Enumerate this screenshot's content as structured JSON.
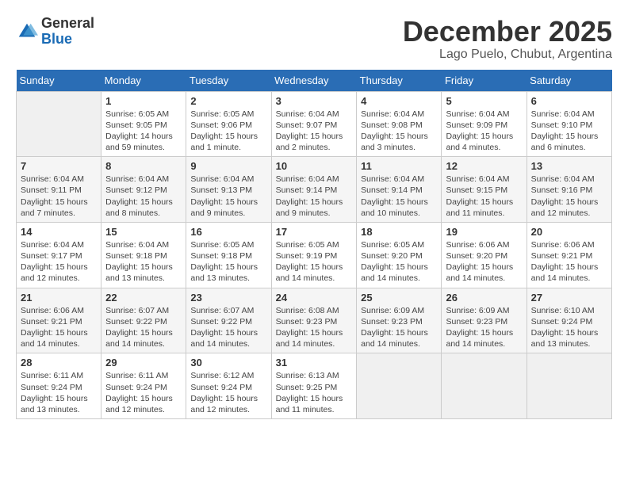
{
  "header": {
    "logo_general": "General",
    "logo_blue": "Blue",
    "month": "December 2025",
    "location": "Lago Puelo, Chubut, Argentina"
  },
  "weekdays": [
    "Sunday",
    "Monday",
    "Tuesday",
    "Wednesday",
    "Thursday",
    "Friday",
    "Saturday"
  ],
  "weeks": [
    [
      {
        "day": "",
        "empty": true
      },
      {
        "day": "1",
        "sunrise": "6:05 AM",
        "sunset": "9:05 PM",
        "daylight": "14 hours and 59 minutes."
      },
      {
        "day": "2",
        "sunrise": "6:05 AM",
        "sunset": "9:06 PM",
        "daylight": "15 hours and 1 minute."
      },
      {
        "day": "3",
        "sunrise": "6:04 AM",
        "sunset": "9:07 PM",
        "daylight": "15 hours and 2 minutes."
      },
      {
        "day": "4",
        "sunrise": "6:04 AM",
        "sunset": "9:08 PM",
        "daylight": "15 hours and 3 minutes."
      },
      {
        "day": "5",
        "sunrise": "6:04 AM",
        "sunset": "9:09 PM",
        "daylight": "15 hours and 4 minutes."
      },
      {
        "day": "6",
        "sunrise": "6:04 AM",
        "sunset": "9:10 PM",
        "daylight": "15 hours and 6 minutes."
      }
    ],
    [
      {
        "day": "7",
        "sunrise": "6:04 AM",
        "sunset": "9:11 PM",
        "daylight": "15 hours and 7 minutes."
      },
      {
        "day": "8",
        "sunrise": "6:04 AM",
        "sunset": "9:12 PM",
        "daylight": "15 hours and 8 minutes."
      },
      {
        "day": "9",
        "sunrise": "6:04 AM",
        "sunset": "9:13 PM",
        "daylight": "15 hours and 9 minutes."
      },
      {
        "day": "10",
        "sunrise": "6:04 AM",
        "sunset": "9:14 PM",
        "daylight": "15 hours and 9 minutes."
      },
      {
        "day": "11",
        "sunrise": "6:04 AM",
        "sunset": "9:14 PM",
        "daylight": "15 hours and 10 minutes."
      },
      {
        "day": "12",
        "sunrise": "6:04 AM",
        "sunset": "9:15 PM",
        "daylight": "15 hours and 11 minutes."
      },
      {
        "day": "13",
        "sunrise": "6:04 AM",
        "sunset": "9:16 PM",
        "daylight": "15 hours and 12 minutes."
      }
    ],
    [
      {
        "day": "14",
        "sunrise": "6:04 AM",
        "sunset": "9:17 PM",
        "daylight": "15 hours and 12 minutes."
      },
      {
        "day": "15",
        "sunrise": "6:04 AM",
        "sunset": "9:18 PM",
        "daylight": "15 hours and 13 minutes."
      },
      {
        "day": "16",
        "sunrise": "6:05 AM",
        "sunset": "9:18 PM",
        "daylight": "15 hours and 13 minutes."
      },
      {
        "day": "17",
        "sunrise": "6:05 AM",
        "sunset": "9:19 PM",
        "daylight": "15 hours and 14 minutes."
      },
      {
        "day": "18",
        "sunrise": "6:05 AM",
        "sunset": "9:20 PM",
        "daylight": "15 hours and 14 minutes."
      },
      {
        "day": "19",
        "sunrise": "6:06 AM",
        "sunset": "9:20 PM",
        "daylight": "15 hours and 14 minutes."
      },
      {
        "day": "20",
        "sunrise": "6:06 AM",
        "sunset": "9:21 PM",
        "daylight": "15 hours and 14 minutes."
      }
    ],
    [
      {
        "day": "21",
        "sunrise": "6:06 AM",
        "sunset": "9:21 PM",
        "daylight": "15 hours and 14 minutes."
      },
      {
        "day": "22",
        "sunrise": "6:07 AM",
        "sunset": "9:22 PM",
        "daylight": "15 hours and 14 minutes."
      },
      {
        "day": "23",
        "sunrise": "6:07 AM",
        "sunset": "9:22 PM",
        "daylight": "15 hours and 14 minutes."
      },
      {
        "day": "24",
        "sunrise": "6:08 AM",
        "sunset": "9:23 PM",
        "daylight": "15 hours and 14 minutes."
      },
      {
        "day": "25",
        "sunrise": "6:09 AM",
        "sunset": "9:23 PM",
        "daylight": "15 hours and 14 minutes."
      },
      {
        "day": "26",
        "sunrise": "6:09 AM",
        "sunset": "9:23 PM",
        "daylight": "15 hours and 14 minutes."
      },
      {
        "day": "27",
        "sunrise": "6:10 AM",
        "sunset": "9:24 PM",
        "daylight": "15 hours and 13 minutes."
      }
    ],
    [
      {
        "day": "28",
        "sunrise": "6:11 AM",
        "sunset": "9:24 PM",
        "daylight": "15 hours and 13 minutes."
      },
      {
        "day": "29",
        "sunrise": "6:11 AM",
        "sunset": "9:24 PM",
        "daylight": "15 hours and 12 minutes."
      },
      {
        "day": "30",
        "sunrise": "6:12 AM",
        "sunset": "9:24 PM",
        "daylight": "15 hours and 12 minutes."
      },
      {
        "day": "31",
        "sunrise": "6:13 AM",
        "sunset": "9:25 PM",
        "daylight": "15 hours and 11 minutes."
      },
      {
        "day": "",
        "empty": true
      },
      {
        "day": "",
        "empty": true
      },
      {
        "day": "",
        "empty": true
      }
    ]
  ],
  "labels": {
    "sunrise_prefix": "Sunrise: ",
    "sunset_prefix": "Sunset: ",
    "daylight_prefix": "Daylight: "
  }
}
